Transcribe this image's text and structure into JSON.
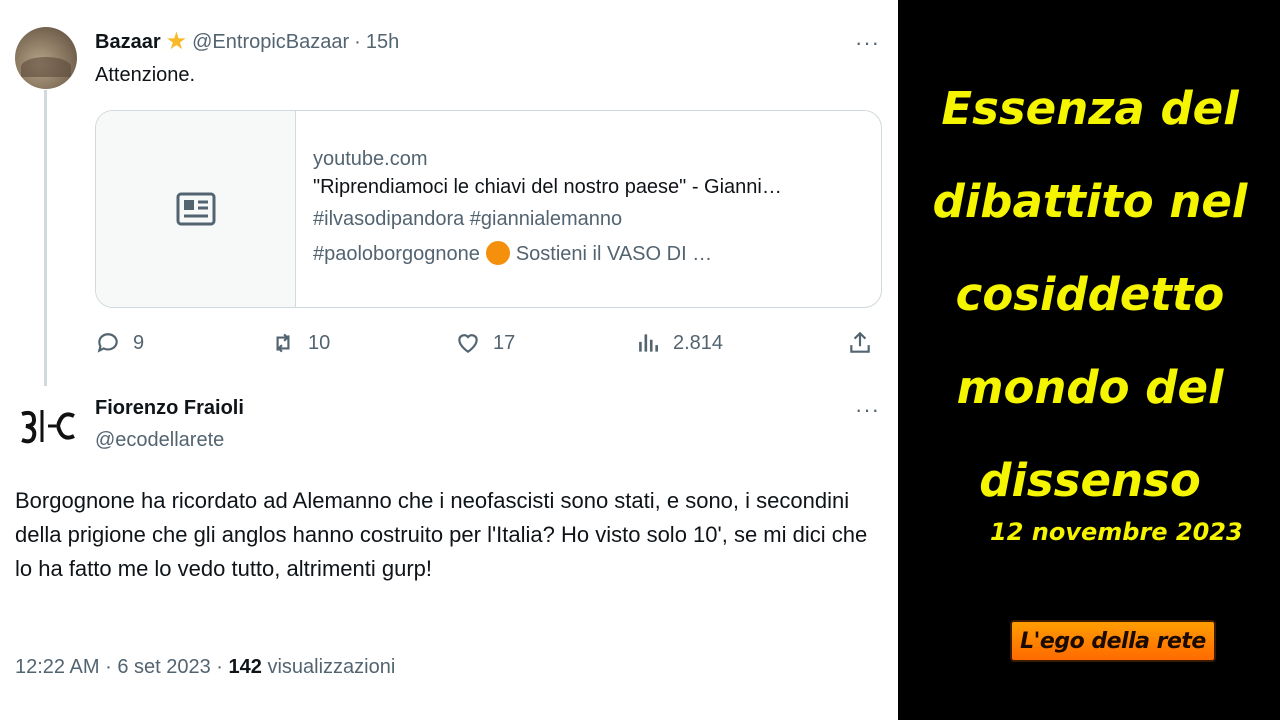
{
  "tweet1": {
    "name": "Bazaar",
    "handle": "@EntropicBazaar",
    "separator": "·",
    "time": "15h",
    "more": "···",
    "text": "Attenzione.",
    "card": {
      "domain": "youtube.com",
      "title": "\"Riprendiamoci le chiavi del nostro paese\" - Gianni…",
      "desc_line1": "#ilvasodipandora #giannialemanno",
      "desc_line2_a": "#paoloborgognone",
      "desc_line2_b": "Sostieni il VASO DI …"
    },
    "actions": {
      "replies": "9",
      "retweets": "10",
      "likes": "17",
      "views": "2.814"
    }
  },
  "tweet2": {
    "name": "Fiorenzo Fraioli",
    "handle": "@ecodellarete",
    "more": "···",
    "text": "Borgognone ha ricordato ad Alemanno che i neofascisti sono stati, e sono, i secondini della prigione che gli anglos hanno costruito per l'Italia? Ho visto solo 10', se mi dici che lo ha fatto me lo vedo tutto, altrimenti gurp!",
    "time": "12:22 AM",
    "separator": "·",
    "date": "6 set 2023",
    "views_count": "142",
    "views_label": "visualizzazioni"
  },
  "overlay": {
    "headline_lines": [
      "Essenza del",
      "dibattito nel",
      "cosiddetto",
      "mondo del",
      "dissenso"
    ],
    "date": "12 novembre 2023",
    "logo_text": "L'ego della rete"
  },
  "colors": {
    "headline": "#f5f500",
    "logo_bg": "#ff8000",
    "star": "#f7b928",
    "secondary_text": "#536471"
  }
}
